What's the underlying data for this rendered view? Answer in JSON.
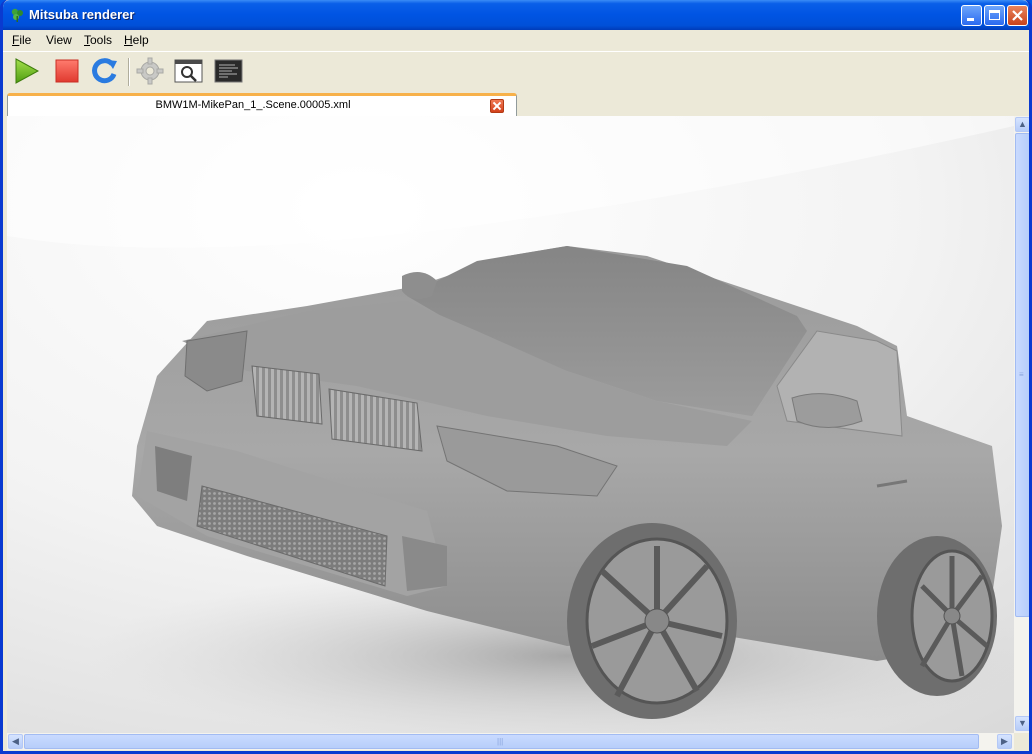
{
  "window": {
    "title": "Mitsuba renderer"
  },
  "menu": [
    {
      "label": "File",
      "mnemonic": "F",
      "rest": "ile"
    },
    {
      "label": "View",
      "mnemonic": "",
      "rest": "View"
    },
    {
      "label": "Tools",
      "mnemonic": "T",
      "rest": "ools"
    },
    {
      "label": "Help",
      "mnemonic": "H",
      "rest": "elp"
    }
  ],
  "toolbar": {
    "buttons": [
      "start-render",
      "stop-render",
      "refresh",
      "settings",
      "preview",
      "console"
    ]
  },
  "tab": {
    "label": "BMW1M-MikePan_1_.Scene.00005.xml"
  },
  "colors": {
    "title_bar": "#0054e3",
    "start_green": "#6cbf1e",
    "stop_red": "#e8433b",
    "refresh_blue": "#2a7be0",
    "tab_accent": "#f7b14a"
  },
  "render": {
    "subject": "car-render-image"
  }
}
